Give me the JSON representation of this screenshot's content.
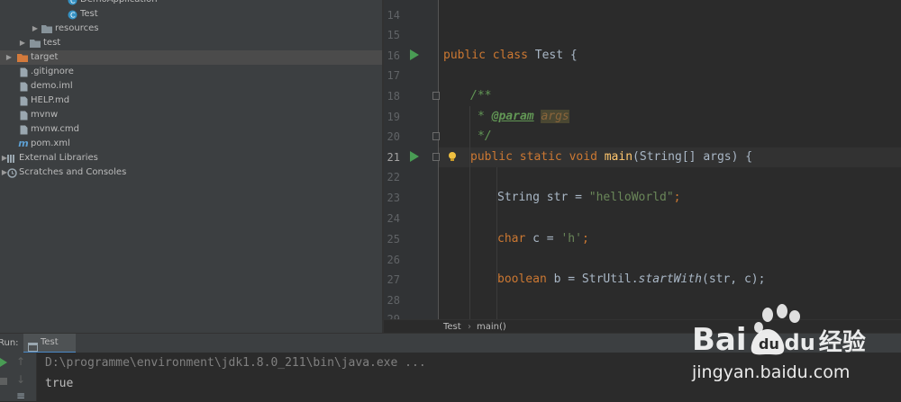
{
  "project_tree": {
    "items": [
      {
        "label": "DemoApplication",
        "icon": "java-class-icon"
      },
      {
        "label": "Test",
        "icon": "java-class-icon"
      },
      {
        "label": "resources",
        "icon": "folder-icon"
      },
      {
        "label": "test",
        "icon": "folder-icon"
      },
      {
        "label": "target",
        "icon": "folder-orange-icon"
      },
      {
        "label": ".gitignore",
        "icon": "file-icon"
      },
      {
        "label": "demo.iml",
        "icon": "file-icon"
      },
      {
        "label": "HELP.md",
        "icon": "file-icon"
      },
      {
        "label": "mvnw",
        "icon": "file-icon"
      },
      {
        "label": "mvnw.cmd",
        "icon": "file-icon"
      },
      {
        "label": "pom.xml",
        "icon": "maven-icon"
      },
      {
        "label": "External Libraries",
        "icon": "library-icon"
      },
      {
        "label": "Scratches and Consoles",
        "icon": "scratches-icon"
      }
    ]
  },
  "editor": {
    "line_numbers": [
      "14",
      "15",
      "16",
      "17",
      "18",
      "19",
      "20",
      "21",
      "22",
      "23",
      "24",
      "25",
      "26",
      "27",
      "28",
      "29"
    ],
    "current_line": "21",
    "code": {
      "l16_kw1": "public",
      "l16_kw2": "class",
      "l16_rest": "Test {",
      "l18": "/**",
      "l19_star": "* ",
      "l19_tag": "@param",
      "l19_param": "args",
      "l20": "*/",
      "l21_kw1": "public",
      "l21_kw2": "static",
      "l21_kw3": "void",
      "l21_fn": "main",
      "l21_rest": "(String[] args) {",
      "l23_a": "String str = ",
      "l23_str": "\"helloWorld\"",
      "l23_b": ";",
      "l25_kw": "char",
      "l25_a": " c = ",
      "l25_str": "'h'",
      "l25_b": ";",
      "l27_kw": "boolean",
      "l27_a": " b = StrUtil.",
      "l27_m": "startWith",
      "l27_b": "(str, c);"
    },
    "breadcrumb": {
      "class": "Test",
      "separator": "›",
      "method": "main()"
    }
  },
  "run_panel": {
    "label": "Run:",
    "tab": "Test",
    "console_lines": [
      "D:\\programme\\environment\\jdk1.8.0_211\\bin\\java.exe ...",
      "true"
    ]
  },
  "watermark": {
    "brand": "Bai",
    "brand2": "du",
    "cn": "经验",
    "url": "jingyan.baidu.com"
  },
  "colors": {
    "keyword": "#cc7832",
    "string": "#6a8759",
    "function": "#ffc66d",
    "run": "#499c54"
  }
}
